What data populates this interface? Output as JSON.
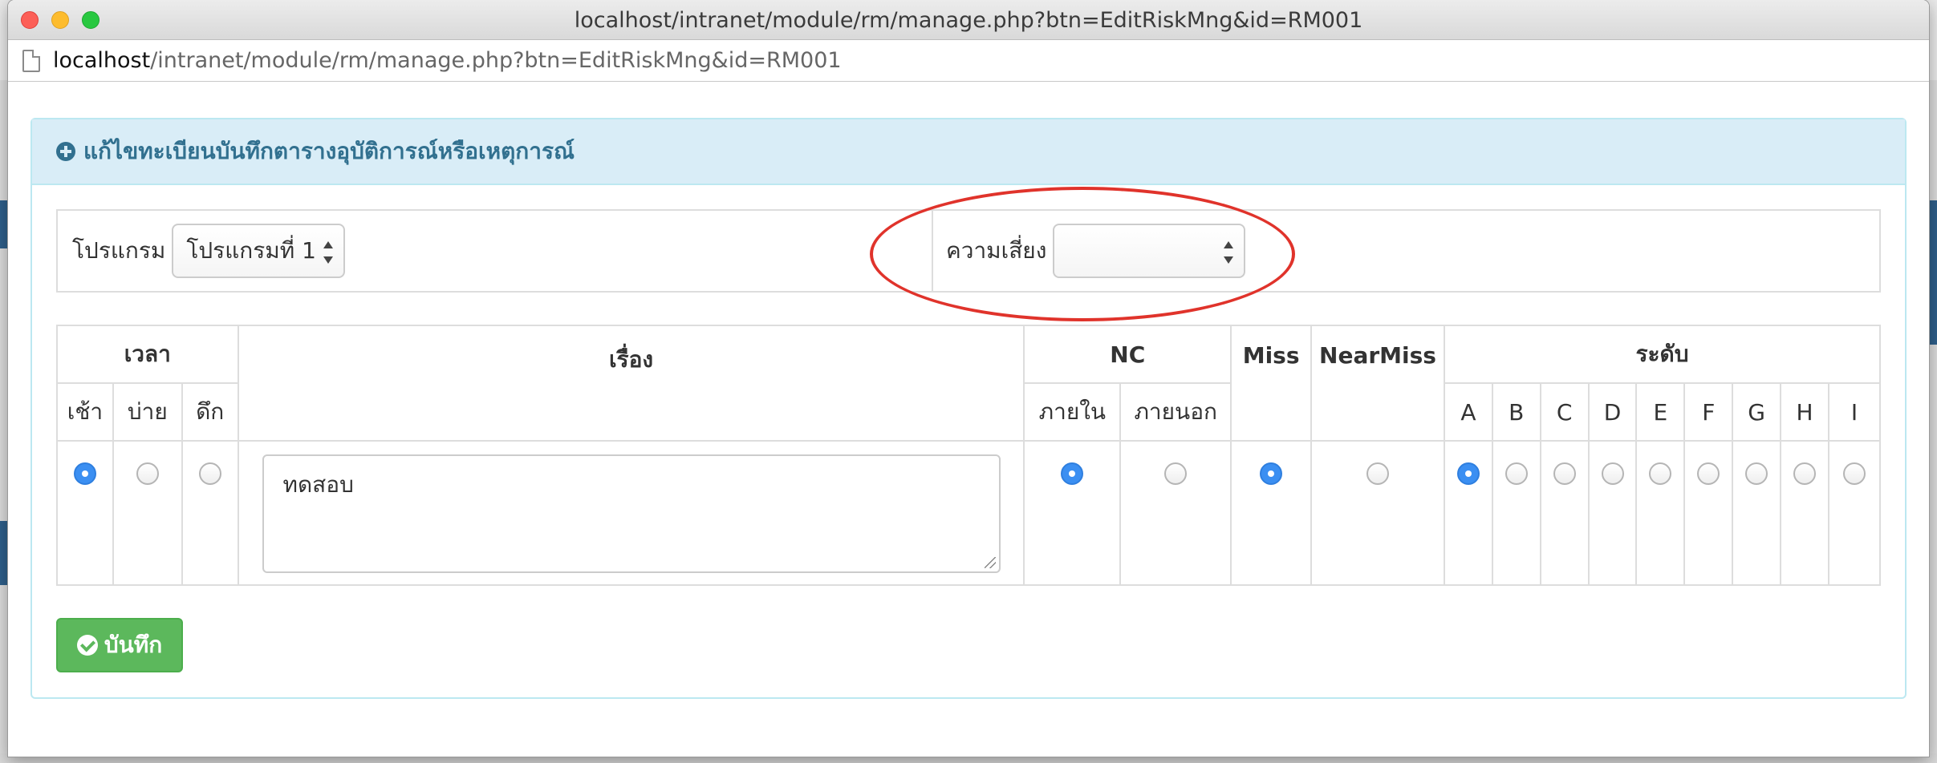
{
  "window": {
    "title": "localhost/intranet/module/rm/manage.php?btn=EditRiskMng&id=RM001",
    "url_host": "localhost",
    "url_path": "/intranet/module/rm/manage.php?btn=EditRiskMng&id=RM001"
  },
  "panel": {
    "heading": "แก้ไขทะเบียนบันทึกตารางอุบัติการณ์หรือเหตุการณ์",
    "heading_icon": "plus-circle-icon"
  },
  "filters": {
    "program_label": "โปรแกรม",
    "program_value": "โปรแกรมที่ 1",
    "risk_label": "ความเสี่ยง",
    "risk_value": ""
  },
  "table": {
    "headers": {
      "time": "เวลา",
      "subject": "เรื่อง",
      "nc": "NC",
      "miss": "Miss",
      "nearmiss": "NearMiss",
      "level": "ระดับ"
    },
    "time_options": [
      "เช้า",
      "บ่าย",
      "ดึก"
    ],
    "nc_options": [
      "ภายใน",
      "ภายนอก"
    ],
    "levels": [
      "A",
      "B",
      "C",
      "D",
      "E",
      "F",
      "G",
      "H",
      "I"
    ],
    "row": {
      "time_selected": 0,
      "subject_text": "ทดสอบ",
      "nc_selected": 0,
      "miss_selected": true,
      "nearmiss_selected": false,
      "level_selected": 0
    }
  },
  "actions": {
    "save_label": "บันทึก",
    "save_icon": "check-circle-icon"
  },
  "colors": {
    "panel_heading_bg": "#d9edf7",
    "panel_heading_text": "#31708f",
    "save_button": "#5cb85c",
    "highlight_ellipse": "#e0332b",
    "radio_selected": "#3b8ff2"
  }
}
